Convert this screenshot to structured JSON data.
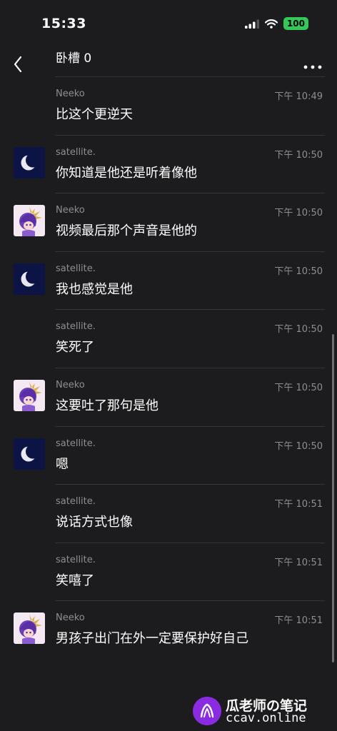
{
  "status_bar": {
    "time": "15:33",
    "battery": "100",
    "icons": [
      "signal-icon",
      "wifi-icon",
      "battery-icon"
    ]
  },
  "header": {
    "title": "卧槽 0",
    "back_icon": "chevron-left-icon",
    "more_icon": "more-icon"
  },
  "messages": [
    {
      "sender": "Neeko",
      "time": "下午 10:49",
      "text": "比这个更逆天",
      "avatar": "none"
    },
    {
      "sender": "satellite.",
      "time": "下午 10:50",
      "text": "你知道是他还是听着像他",
      "avatar": "moon"
    },
    {
      "sender": "Neeko",
      "time": "下午 10:50",
      "text": "视频最后那个声音是他的",
      "avatar": "anime"
    },
    {
      "sender": "satellite.",
      "time": "下午 10:50",
      "text": "我也感觉是他",
      "avatar": "moon"
    },
    {
      "sender": "satellite.",
      "time": "下午 10:50",
      "text": "笑死了",
      "avatar": "none"
    },
    {
      "sender": "Neeko",
      "time": "下午 10:50",
      "text": "这要吐了那句是他",
      "avatar": "anime"
    },
    {
      "sender": "satellite.",
      "time": "下午 10:50",
      "text": "嗯",
      "avatar": "moon"
    },
    {
      "sender": "satellite.",
      "time": "下午 10:51",
      "text": "说话方式也像",
      "avatar": "none"
    },
    {
      "sender": "satellite.",
      "time": "下午 10:51",
      "text": "笑嘻了",
      "avatar": "none"
    },
    {
      "sender": "Neeko",
      "time": "下午 10:51",
      "text": "男孩子出门在外一定要保护好自己",
      "avatar": "anime"
    }
  ],
  "watermark": {
    "title": "瓜老师の笔记",
    "url": "ccav.online",
    "logo_color": "#8a2be2"
  },
  "colors": {
    "background": "#1c1c1e",
    "meta_text": "#8e8e93",
    "battery": "#34c759"
  }
}
